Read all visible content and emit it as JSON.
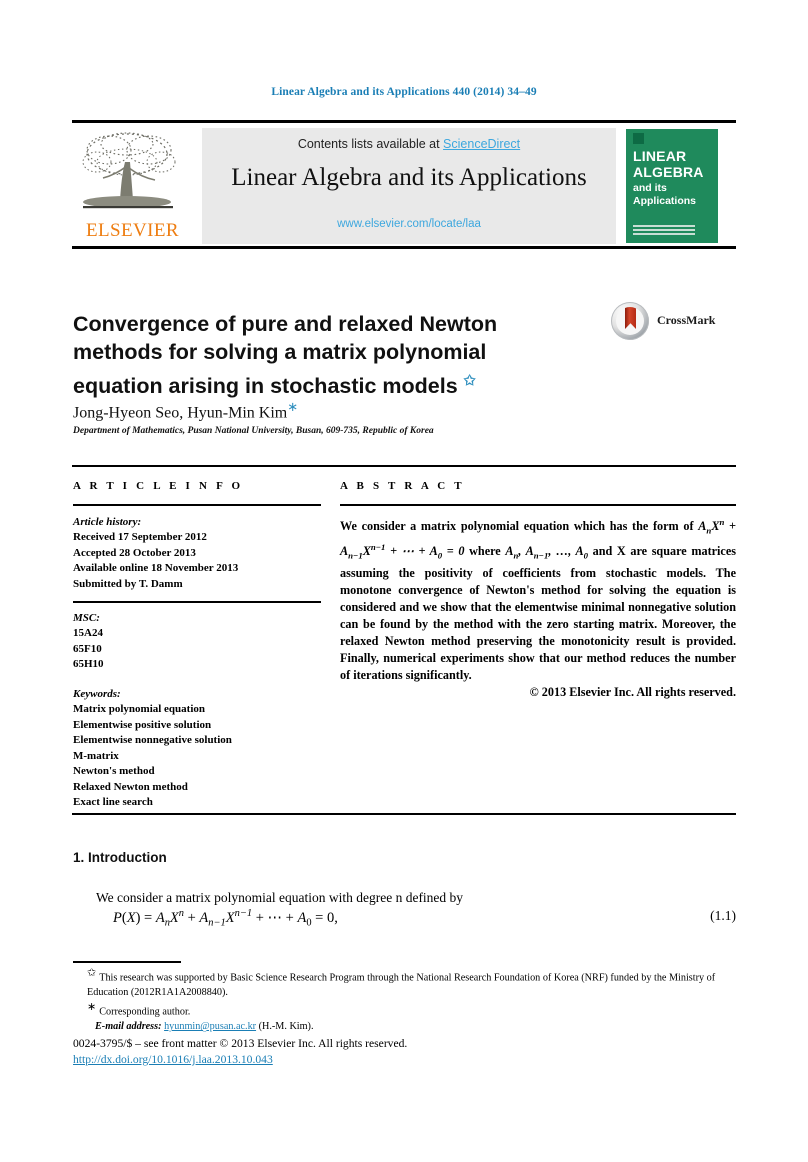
{
  "masthead": {
    "citation": "Linear Algebra and its Applications 440 (2014) 34–49"
  },
  "header": {
    "contents_prefix": "Contents lists available at ",
    "sciencedirect": "ScienceDirect",
    "journal_title": "Linear Algebra and its Applications",
    "journal_url": "www.elsevier.com/locate/laa",
    "publisher": "ELSEVIER",
    "cover": {
      "line1": "LINEAR",
      "line2": "ALGEBRA",
      "line3": "and its",
      "line4": "Applications"
    }
  },
  "article": {
    "title": "Convergence of pure and relaxed Newton methods for solving a matrix polynomial equation arising in stochastic models",
    "title_footnote_mark": "✩",
    "authors": "Jong-Hyeon Seo, Hyun-Min Kim",
    "author_footnote_mark": "∗",
    "affiliation": "Department of Mathematics, Pusan National University, Busan, 609-735, Republic of Korea",
    "crossmark_label": "CrossMark"
  },
  "info": {
    "label": "A R T I C L E    I N F O",
    "history_heading": "Article history:",
    "history": [
      "Received 17 September 2012",
      "Accepted 28 October 2013",
      "Available online 18 November 2013",
      "Submitted by T. Damm"
    ],
    "msc_heading": "MSC:",
    "msc": [
      "15A24",
      "65F10",
      "65H10"
    ],
    "keywords_heading": "Keywords:",
    "keywords": [
      "Matrix polynomial equation",
      "Elementwise positive solution",
      "Elementwise nonnegative solution",
      "M-matrix",
      "Newton's method",
      "Relaxed Newton method",
      "Exact line search"
    ]
  },
  "abstract": {
    "label": "A B S T R A C T",
    "text_parts": {
      "p1": "We consider a matrix polynomial equation which has the form of ",
      "eq": "AnXn + An−1Xn−1 + ⋯ + A0 = 0",
      "p2": " where ",
      "coeffs": "An, An−1, …, A0",
      "p3": " and X are square matrices assuming the positivity of coefficients from stochastic models. The monotone convergence of Newton's method for solving the equation is considered and we show that the elementwise minimal nonnegative solution can be found by the method with the zero starting matrix. Moreover, the relaxed Newton method preserving the monotonicity result is provided. Finally, numerical experiments show that our method reduces the number of iterations significantly."
    },
    "copyright": "© 2013 Elsevier Inc. All rights reserved."
  },
  "introduction": {
    "heading": "1. Introduction",
    "paragraph": "We consider a matrix polynomial equation with degree n defined by",
    "equation_text": "P(X) = AnXn + An−1Xn−1 + ⋯ + A0 = 0,",
    "equation_number": "(1.1)"
  },
  "footnotes": {
    "funding_mark": "✩",
    "funding": "This research was supported by Basic Science Research Program through the National Research Foundation of Korea (NRF) funded by the Ministry of Education (2012R1A1A2008840).",
    "corresponding_mark": "∗",
    "corresponding": "Corresponding author.",
    "email_label": "E-mail address:",
    "email": "hyunmin@pusan.ac.kr",
    "email_owner": "(H.-M. Kim)."
  },
  "imprint": {
    "issn_line": "0024-3795/$ – see front matter © 2013 Elsevier Inc. All rights reserved.",
    "doi": "http://dx.doi.org/10.1016/j.laa.2013.10.043"
  },
  "colors": {
    "link": "#1a7eb5",
    "sciencedirect": "#3da7de",
    "elsevier_orange": "#ee7d11",
    "cover_green": "#1f8a5c",
    "footnote_star": "#2f8fbe"
  }
}
